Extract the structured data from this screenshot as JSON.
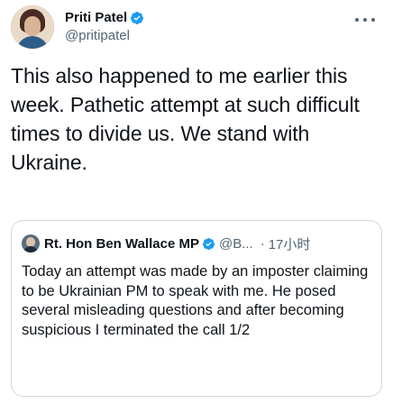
{
  "author": {
    "display_name": "Priti Patel",
    "handle": "@pritipatel",
    "verified": true,
    "avatar": "profile-photo"
  },
  "menu": {
    "icon": "more-horizontal-icon"
  },
  "tweet": {
    "text": "This also happened to me earlier this week. Pathetic attempt at such difficult times to divide us. We stand with Ukraine."
  },
  "quoted_tweet": {
    "display_name": "Rt. Hon Ben Wallace MP",
    "verified": true,
    "handle": "@B...",
    "separator": "·",
    "time": "17小时",
    "text": "Today an attempt was made by an imposter claiming to be Ukrainian PM to speak with me. He posed several misleading questions and after becoming suspicious I terminated the call 1/2"
  },
  "colors": {
    "text_primary": "#0f1419",
    "text_secondary": "#536471",
    "verified_blue": "#1d9bf0",
    "border": "#cfd9de"
  }
}
